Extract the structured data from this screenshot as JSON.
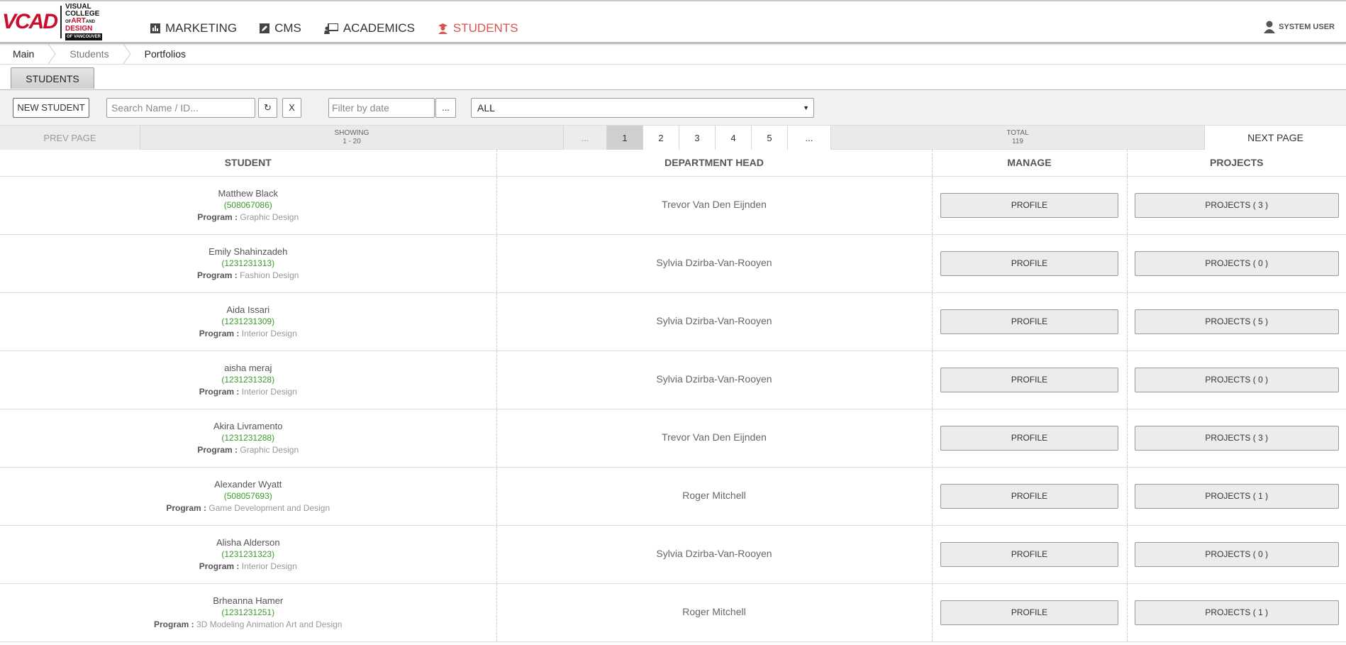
{
  "logo": {
    "mark": "VCAD",
    "line1": "VISUAL",
    "line2": "COLLEGE",
    "line3a": "OF",
    "line3b": "ART",
    "line3c": "AND",
    "line4": "DESIGN",
    "line5": "OF VANCOUVER"
  },
  "nav": {
    "marketing": "MARKETING",
    "cms": "CMS",
    "academics": "ACADEMICS",
    "students": "STUDENTS",
    "active_color": "#d9534f"
  },
  "user": {
    "label": "SYSTEM USER"
  },
  "breadcrumb": {
    "main": "Main",
    "students": "Students",
    "portfolios": "Portfolios"
  },
  "tab": {
    "label": "STUDENTS"
  },
  "toolbar": {
    "new_student": "NEW STUDENT",
    "search_placeholder": "Search Name / ID...",
    "refresh": "↻",
    "clear": "X",
    "date_placeholder": "Filter by date",
    "date_more": "...",
    "select_value": "ALL"
  },
  "pager": {
    "prev": "PREV PAGE",
    "showing_label": "SHOWING",
    "showing_range": "1 - 20",
    "dots": "...",
    "pages": [
      "1",
      "2",
      "3",
      "4",
      "5"
    ],
    "current_page": "1",
    "total_label": "TOTAL",
    "total_value": "119",
    "next": "NEXT PAGE"
  },
  "table": {
    "headers": {
      "student": "STUDENT",
      "dept": "DEPARTMENT HEAD",
      "manage": "MANAGE",
      "projects": "PROJECTS"
    },
    "program_label": "Program :",
    "profile_label": "PROFILE",
    "rows": [
      {
        "name": "Matthew Black",
        "id": "(508067086)",
        "program": "Graphic Design",
        "dept": "Trevor Van Den Eijnden",
        "projects": "PROJECTS ( 3 )"
      },
      {
        "name": "Emily Shahinzadeh",
        "id": "(1231231313)",
        "program": "Fashion Design",
        "dept": "Sylvia Dzirba-Van-Rooyen",
        "projects": "PROJECTS ( 0 )"
      },
      {
        "name": "Aida Issari",
        "id": "(1231231309)",
        "program": "Interior Design",
        "dept": "Sylvia Dzirba-Van-Rooyen",
        "projects": "PROJECTS ( 5 )"
      },
      {
        "name": "aisha meraj",
        "id": "(1231231328)",
        "program": "Interior Design",
        "dept": "Sylvia Dzirba-Van-Rooyen",
        "projects": "PROJECTS ( 0 )"
      },
      {
        "name": "Akira Livramento",
        "id": "(1231231288)",
        "program": "Graphic Design",
        "dept": "Trevor Van Den Eijnden",
        "projects": "PROJECTS ( 3 )"
      },
      {
        "name": "Alexander Wyatt",
        "id": "(508057693)",
        "program": "Game Development and Design",
        "dept": "Roger Mitchell",
        "projects": "PROJECTS ( 1 )"
      },
      {
        "name": "Alisha Alderson",
        "id": "(1231231323)",
        "program": "Interior Design",
        "dept": "Sylvia Dzirba-Van-Rooyen",
        "projects": "PROJECTS ( 0 )"
      },
      {
        "name": "Brheanna Hamer",
        "id": "(1231231251)",
        "program": "3D Modeling Animation Art and Design",
        "dept": "Roger Mitchell",
        "projects": "PROJECTS ( 1 )"
      }
    ]
  }
}
